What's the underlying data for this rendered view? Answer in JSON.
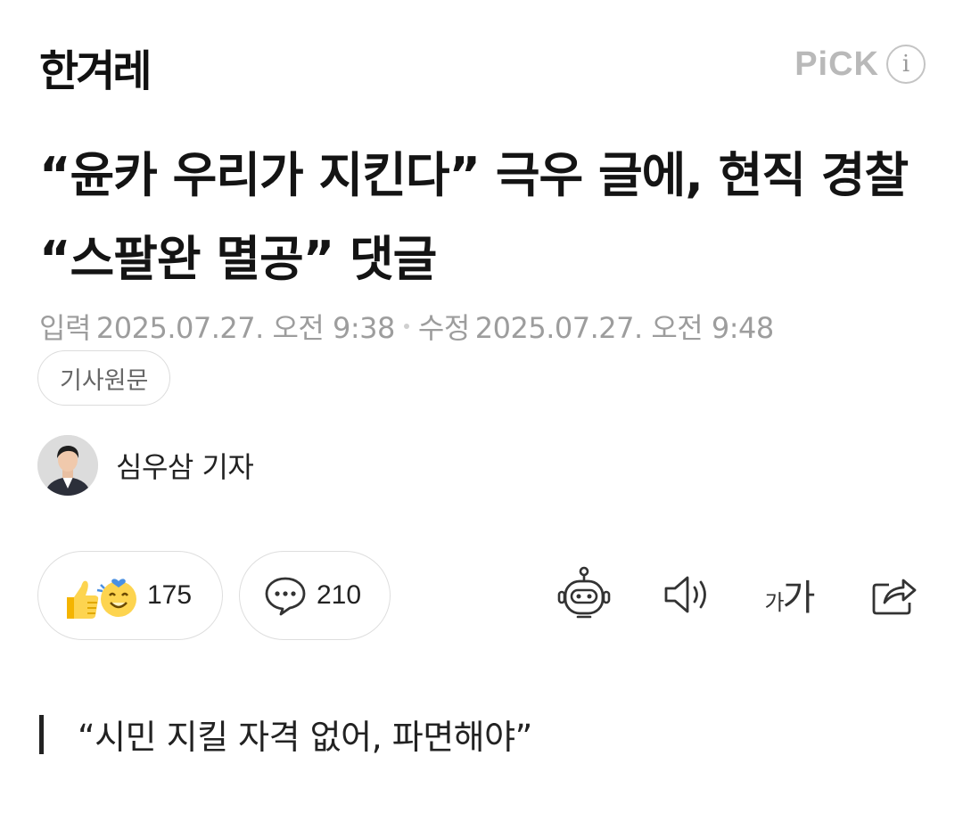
{
  "header": {
    "logo": "한겨레",
    "pick_label": "PiCK",
    "info_icon": "i"
  },
  "article": {
    "headline": "“윤카 우리가 지킨다” 극우 글에, 현직 경찰 “스팔완 멸공” 댓글",
    "published_label": "입력",
    "published": "2025.07.27. 오전 9:38",
    "modified_label": "수정",
    "modified": "2025.07.27. 오전 9:48",
    "source_button": "기사원문",
    "author": "심우삼 기자",
    "subheading": "“시민 지킬 자격 없어, 파면해야”"
  },
  "actions": {
    "reaction_count": "175",
    "comment_count": "210",
    "font_icon_small": "가",
    "font_icon_large": "가"
  },
  "colors": {
    "text": "#141414",
    "meta": "#9d9d9d",
    "border": "#dedede",
    "pick": "#b9b9b9"
  }
}
